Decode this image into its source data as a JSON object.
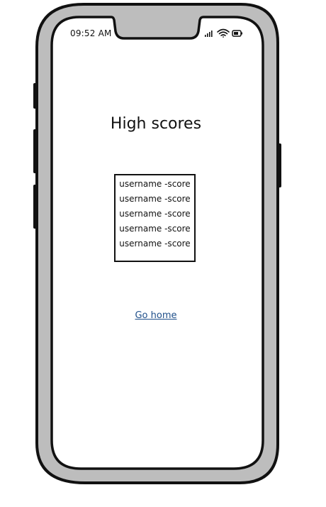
{
  "status_bar": {
    "time": "09:52 AM",
    "icons": [
      "signal-icon",
      "wifi-icon",
      "battery-icon"
    ]
  },
  "page": {
    "title": "High scores"
  },
  "scores": [
    {
      "label": "username -score"
    },
    {
      "label": "username -score"
    },
    {
      "label": "username -score"
    },
    {
      "label": "username -score"
    },
    {
      "label": "username -score"
    }
  ],
  "nav": {
    "home_link": "Go home"
  },
  "colors": {
    "frame": "#bdbdbd",
    "outline": "#111111",
    "screen": "#ffffff",
    "link": "#1f4f8a"
  }
}
